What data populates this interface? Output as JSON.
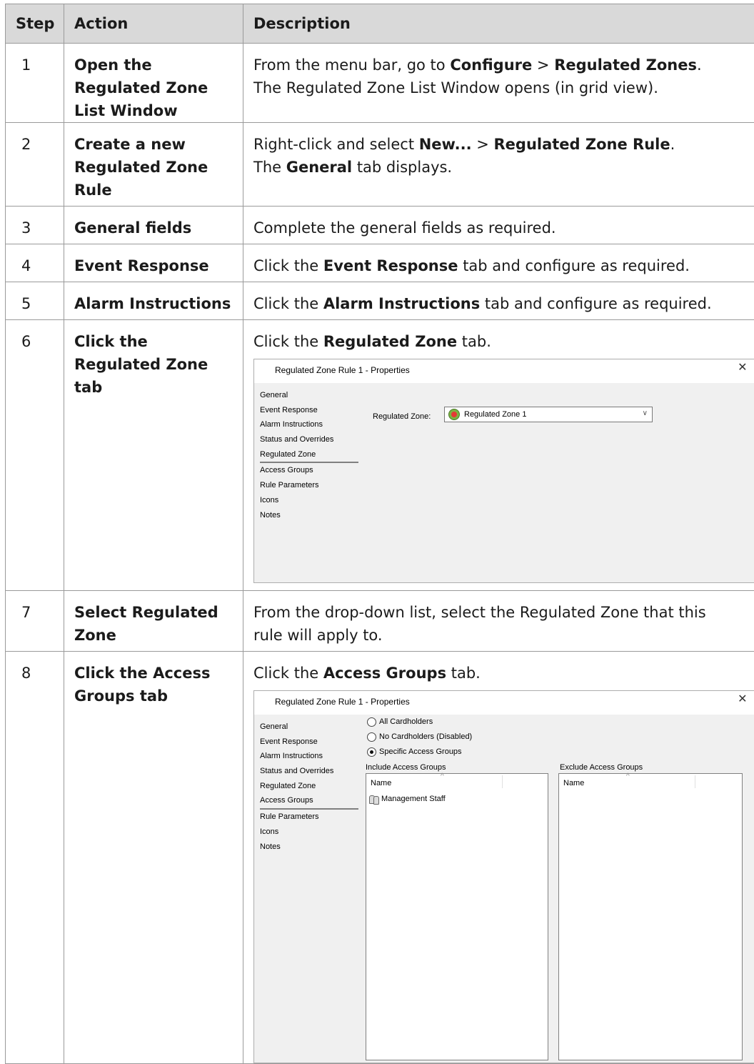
{
  "table": {
    "headers": {
      "step": "Step",
      "action": "Action",
      "description": "Description"
    },
    "rows": [
      {
        "step": "1",
        "action": "Open the Regulated Zone List Window",
        "d1": "From the menu bar, go to ",
        "d1b": "Configure",
        "d1c": " > ",
        "d1d": "Regulated Zones",
        "d1e": ".",
        "d2": "The Regulated Zone List Window opens (in grid view)."
      },
      {
        "step": "2",
        "action": "Create a new Regulated Zone Rule",
        "d1": "Right-click and select ",
        "d1b": "New...",
        "d1c": " > ",
        "d1d": "Regulated Zone Rule",
        "d1e": ".",
        "d2": "The ",
        "d2b": "General",
        "d2c": " tab displays."
      },
      {
        "step": "3",
        "action": "General fields",
        "d1": "Complete the general fields as required."
      },
      {
        "step": "4",
        "action": "Event Response",
        "d1": "Click the ",
        "d1b": "Event Response",
        "d1c": " tab and configure as required."
      },
      {
        "step": "5",
        "action": "Alarm Instructions",
        "d1": "Click the ",
        "d1b": "Alarm Instructions",
        "d1c": " tab and configure as required."
      },
      {
        "step": "6",
        "action": "Click the Regulated Zone tab",
        "d1": "Click the ",
        "d1b": "Regulated Zone",
        "d1c": " tab."
      },
      {
        "step": "7",
        "action": "Select Regulated Zone",
        "d1": "From the drop-down list, select the Regulated Zone that this rule will apply to."
      },
      {
        "step": "8",
        "action": "Click the Access Groups tab",
        "d1": "Click the ",
        "d1b": "Access Groups",
        "d1c": " tab."
      }
    ]
  },
  "dialog1": {
    "title": "Regulated Zone Rule 1 - Properties",
    "close": "✕",
    "nav": [
      "General",
      "Event Response",
      "Alarm Instructions",
      "Status and Overrides",
      "Regulated Zone",
      "Access Groups",
      "Rule Parameters",
      "Icons",
      "Notes"
    ],
    "field_label": "Regulated Zone:",
    "field_value": "Regulated Zone 1",
    "chevron": "∨"
  },
  "dialog2": {
    "title": "Regulated Zone Rule 1 - Properties",
    "close": "✕",
    "nav": [
      "General",
      "Event Response",
      "Alarm Instructions",
      "Status and Overrides",
      "Regulated Zone",
      "Access Groups",
      "Rule Parameters",
      "Icons",
      "Notes"
    ],
    "radios": [
      "All Cardholders",
      "No Cardholders (Disabled)",
      "Specific Access Groups"
    ],
    "include_label": "Include Access Groups",
    "exclude_label": "Exclude Access Groups",
    "col_name": "Name",
    "sort_caret": "^",
    "include_items": [
      "Management Staff"
    ]
  }
}
